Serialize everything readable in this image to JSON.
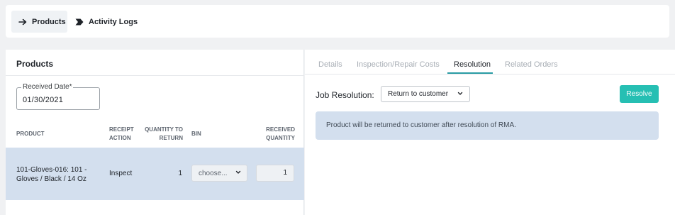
{
  "nav": {
    "tabs": [
      {
        "label": "Products",
        "icon": "arrow-right-icon",
        "active": true
      },
      {
        "label": "Activity Logs",
        "icon": "chevron-flag-icon",
        "active": false
      }
    ]
  },
  "products": {
    "title": "Products",
    "received_date": {
      "label": "Received Date*",
      "value": "01/30/2021"
    },
    "columns": {
      "product": "Product",
      "receipt_action": "Receipt Action",
      "quantity_to_return": "Quantity to Return",
      "bin": "Bin",
      "received_quantity": "Received Quantity"
    },
    "rows": [
      {
        "product": "101-Gloves-016: 101 - Gloves / Black / 14 Oz",
        "receipt_action": "Inspect",
        "quantity_to_return": "1",
        "bin_placeholder": "choose...",
        "received_quantity": "1"
      }
    ]
  },
  "resolution_panel": {
    "tabs": [
      {
        "label": "Details",
        "active": false
      },
      {
        "label": "Inspection/Repair Costs",
        "active": false
      },
      {
        "label": "Resolution",
        "active": true
      },
      {
        "label": "Related Orders",
        "active": false
      }
    ],
    "job_resolution": {
      "label": "Job Resolution:",
      "selected": "Return to customer"
    },
    "resolve_label": "Resolve",
    "info_message": "Product will be returned to customer after resolution of RMA."
  },
  "colors": {
    "accent": "#26bfb3",
    "tab_underline": "#2a9ca4",
    "selected_row": "#d3dfee",
    "banner": "#d3dfee"
  }
}
